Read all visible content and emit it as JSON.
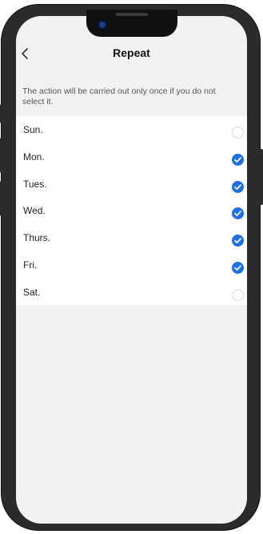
{
  "nav": {
    "title": "Repeat",
    "back_icon": "chevron-left-icon"
  },
  "hint": "The action will be carried out only once if you do not select it.",
  "days": [
    {
      "label": "Sun.",
      "checked": false
    },
    {
      "label": "Mon.",
      "checked": true
    },
    {
      "label": "Tues.",
      "checked": true
    },
    {
      "label": "Wed.",
      "checked": true
    },
    {
      "label": "Thurs.",
      "checked": true
    },
    {
      "label": "Fri.",
      "checked": true
    },
    {
      "label": "Sat.",
      "checked": false
    }
  ],
  "colors": {
    "accent": "#1f6fe5",
    "unchecked_border": "#d8d8dc",
    "background": "#f2f2f4",
    "list_background": "#ffffff"
  }
}
